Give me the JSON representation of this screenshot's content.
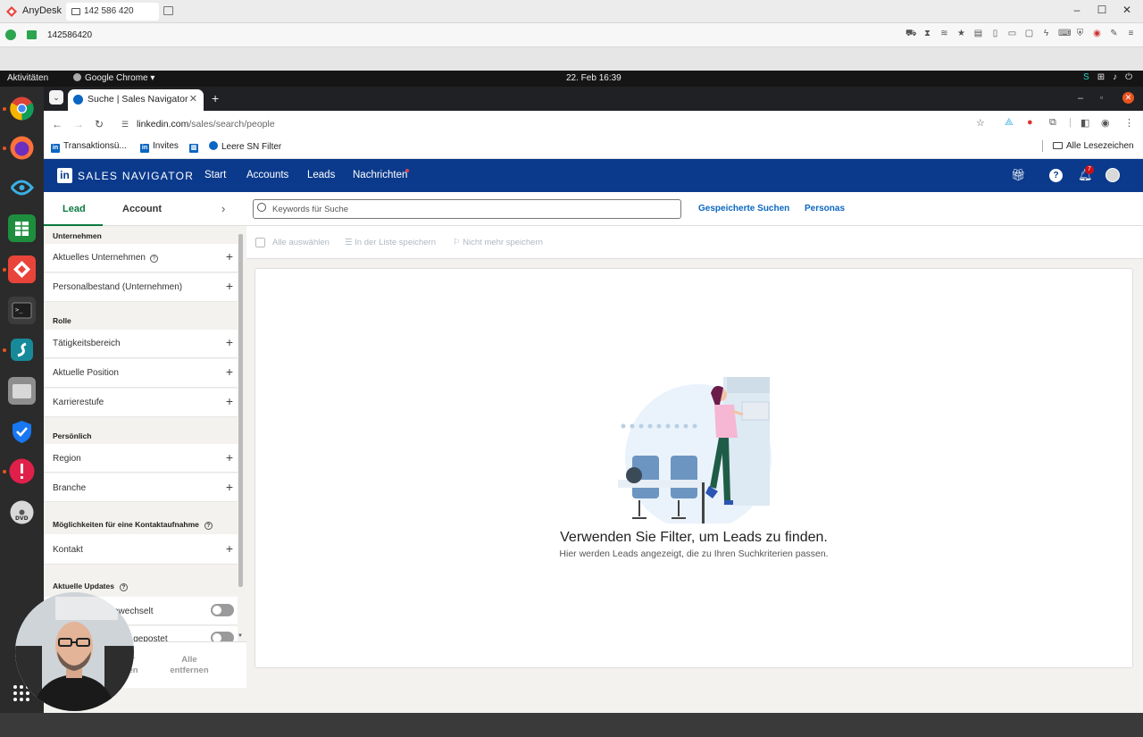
{
  "anydesk": {
    "app_name": "AnyDesk",
    "tab_id": "142 586 420",
    "address_id": "142586420",
    "toolbar_icons": [
      "car-icon",
      "hourglass-icon",
      "stack-icon",
      "star-icon",
      "file-icon",
      "phone-icon",
      "monitor-icon",
      "chat-icon",
      "lightning-icon",
      "keyboard-icon",
      "shield-icon",
      "record-icon",
      "pen-icon",
      "menu-icon"
    ]
  },
  "gnome": {
    "activities": "Aktivitäten",
    "app_menu": "Google Chrome ▾",
    "datetime": "22. Feb  16:39"
  },
  "chrome": {
    "tab_title": "Suche | Sales Navigator",
    "url_host": "linkedin.com",
    "url_path": "/sales/search/people",
    "bookmarks": [
      "Transaktionsü...",
      "Invites",
      "",
      "Leere SN Filter"
    ],
    "bookmark_folder": "Alle Lesezeichen"
  },
  "sn": {
    "brand": "SALES NAVIGATOR",
    "nav": [
      "Start",
      "Accounts",
      "Leads",
      "Nachrichten"
    ],
    "notification_count": "7",
    "colors": {
      "nav_bg": "#0b3a8c",
      "accent": "#0a66c2"
    }
  },
  "filters": {
    "tab_lead": "Lead",
    "tab_account": "Account",
    "sections": {
      "unternehmen": "Unternehmen",
      "rolle": "Rolle",
      "persoenlich": "Persönlich",
      "kontakt": "Möglichkeiten für eine Kontaktaufnahme",
      "updates": "Aktuelle Updates"
    },
    "rows": {
      "aktuelles_unternehmen": "Aktuelles Unternehmen",
      "personalbestand": "Personalbestand (Unternehmen)",
      "taetigkeitsbereich": "Tätigkeitsbereich",
      "aktuelle_position": "Aktuelle Position",
      "karrierestufe": "Karrierestufe",
      "region": "Region",
      "branche": "Branche",
      "kontakt": "Kontakt",
      "gewechselt": "ewechselt",
      "gepostet": "edIn gepostet"
    },
    "footer": {
      "left": "r\nen",
      "right": "Alle\nentfernen"
    }
  },
  "search": {
    "placeholder": "Keywords für Suche",
    "saved": "Gespeicherte Suchen",
    "personas": "Personas"
  },
  "actions": {
    "select_all": "Alle auswählen",
    "save_list": "In der Liste speichern",
    "unsave": "Nicht mehr speichern"
  },
  "empty": {
    "title": "Verwenden Sie Filter, um Leads zu finden.",
    "subtitle": "Hier werden Leads angezeigt, die zu Ihren Suchkriterien passen."
  }
}
